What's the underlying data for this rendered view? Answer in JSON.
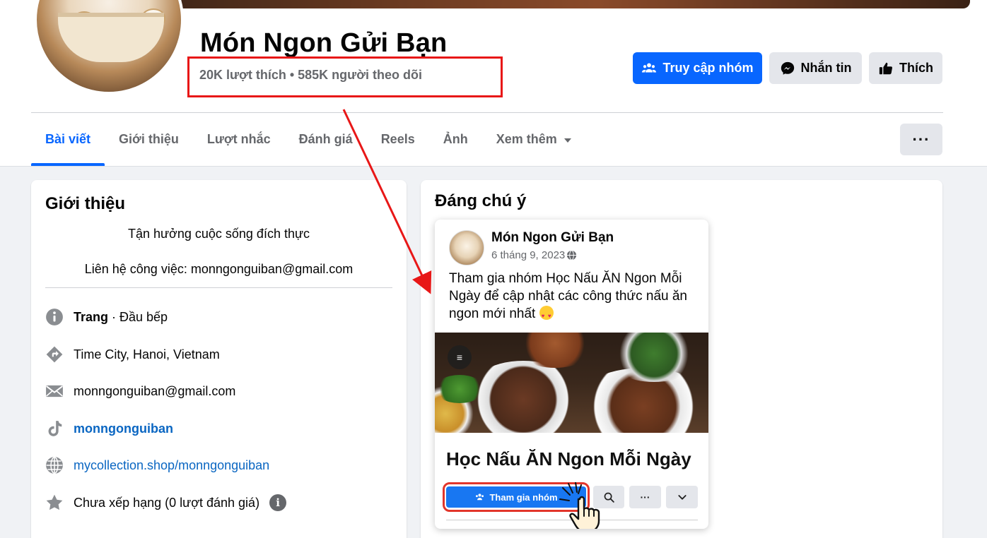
{
  "page": {
    "name": "Món Ngon Gửi Bạn",
    "stats": "20K lượt thích • 585K người theo dõi"
  },
  "actions": {
    "visit_group": "Truy cập nhóm",
    "message": "Nhắn tin",
    "like": "Thích",
    "more": "···"
  },
  "tabs": [
    {
      "label": "Bài viết",
      "active": true
    },
    {
      "label": "Giới thiệu"
    },
    {
      "label": "Lượt nhắc"
    },
    {
      "label": "Đánh giá"
    },
    {
      "label": "Reels"
    },
    {
      "label": "Ảnh"
    },
    {
      "label": "Xem thêm"
    }
  ],
  "intro": {
    "title": "Giới thiệu",
    "bio": "Tận hưởng cuộc sống đích thực",
    "contact": "Liên hệ công việc: monngonguiban@gmail.com",
    "items": {
      "page_type_bold": "Trang",
      "page_type_rest": " · Đầu bếp",
      "location": "Time City, Hanoi, Vietnam",
      "email": "monngonguiban@gmail.com",
      "tiktok": "monngonguiban",
      "website": "mycollection.shop/monngonguiban",
      "rating": "Chưa xếp hạng (0 lượt đánh giá)"
    }
  },
  "featured": {
    "title": "Đáng chú ý",
    "post": {
      "author": "Món Ngon Gửi Bạn",
      "date": "6 tháng 9, 2023",
      "text": "Tham gia nhóm Học Nấu ĂN Ngon Mỗi Ngày để cập nhật các công thức nấu ăn ngon mới nhất",
      "group_name": "Học Nấu ĂN Ngon Mỗi Ngày",
      "join_label": "Tham gia nhóm",
      "more_dots": "···",
      "menu_glyph": "≡"
    }
  },
  "colors": {
    "primary": "#0866ff",
    "highlight": "#e81717",
    "link": "#0a66c2"
  }
}
